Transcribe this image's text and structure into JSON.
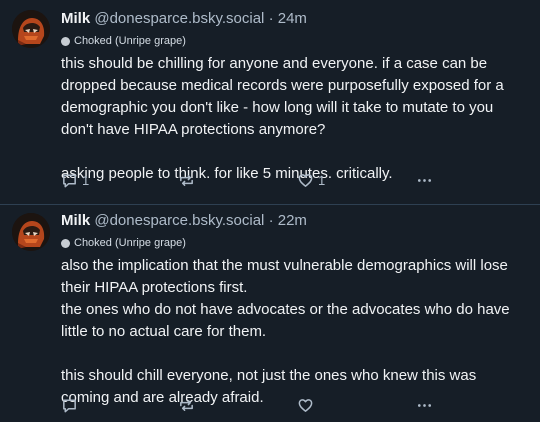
{
  "posts": [
    {
      "author": {
        "name": "Milk",
        "handle": "@donesparce.bsky.social",
        "time": "24m"
      },
      "label": "Choked (Unripe grape)",
      "paragraphs": [
        "this should be chilling for anyone and everyone. if a case can be dropped because medical records were purposefully exposed for a demographic you don't like - how long will it take to mutate to you don't have HIPAA protections anymore?",
        "asking people to think. for like 5 minutes. critically."
      ],
      "counts": {
        "reply": "1",
        "repost": "",
        "like": "1"
      }
    },
    {
      "author": {
        "name": "Milk",
        "handle": "@donesparce.bsky.social",
        "time": "22m"
      },
      "label": "Choked (Unripe grape)",
      "paragraphs": [
        "also the implication that the must vulnerable demographics will lose their HIPAA protections first.\nthe ones who do not have advocates or the advocates who do have little to no actual care for them.",
        "this should chill everyone, not just the ones who knew this was coming and are already afraid."
      ],
      "counts": {
        "reply": "",
        "repost": "",
        "like": ""
      }
    }
  ],
  "separator": "·",
  "icons": [
    "reply-icon",
    "repost-icon",
    "like-icon",
    "more-icon"
  ],
  "colors": {
    "background": "#161e27",
    "text": "#f1f3f5",
    "muted": "#aebbc9",
    "divider": "#2e4052"
  }
}
